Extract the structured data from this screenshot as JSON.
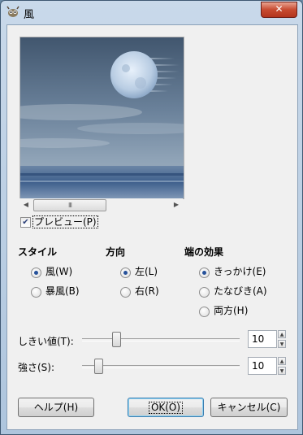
{
  "window": {
    "title": "風"
  },
  "preview": {
    "show_preview_label": "プレビュー(P)",
    "checked": true,
    "scroll_grip": "III"
  },
  "style_group": {
    "title": "スタイル",
    "options": [
      {
        "label": "風(W)",
        "selected": true
      },
      {
        "label": "暴風(B)",
        "selected": false
      }
    ]
  },
  "direction_group": {
    "title": "方向",
    "options": [
      {
        "label": "左(L)",
        "selected": true
      },
      {
        "label": "右(R)",
        "selected": false
      }
    ]
  },
  "edge_group": {
    "title": "端の効果",
    "options": [
      {
        "label": "きっかけ(E)",
        "selected": true
      },
      {
        "label": "たなびき(A)",
        "selected": false
      },
      {
        "label": "両方(H)",
        "selected": false
      }
    ]
  },
  "threshold": {
    "label": "しきい値(T):",
    "value": "10"
  },
  "strength": {
    "label": "強さ(S):",
    "value": "10"
  },
  "buttons": {
    "help": "ヘルプ(H)",
    "ok": "OK(O)",
    "cancel": "キャンセル(C)"
  },
  "colors": {
    "title_bar": "#aec5dd",
    "close_button": "#c74a30",
    "dialog_bg": "#f0f0f0",
    "radio_dot": "#26519a"
  }
}
